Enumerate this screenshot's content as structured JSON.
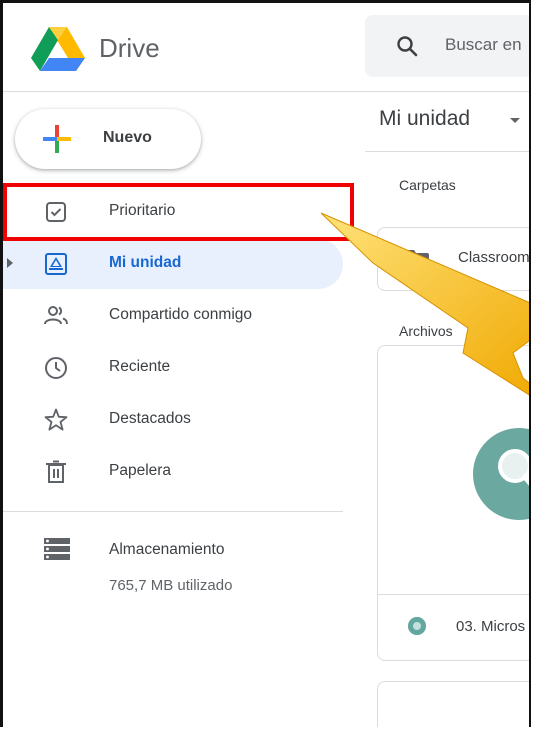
{
  "header": {
    "brand": "Drive",
    "search_placeholder": "Buscar en"
  },
  "sidebar": {
    "new_button": "Nuevo",
    "items": [
      {
        "label": "Prioritario",
        "icon": "checkbox-icon"
      },
      {
        "label": "Mi unidad",
        "icon": "my-drive-icon"
      },
      {
        "label": "Compartido conmigo",
        "icon": "shared-people-icon"
      },
      {
        "label": "Reciente",
        "icon": "clock-icon"
      },
      {
        "label": "Destacados",
        "icon": "star-icon"
      },
      {
        "label": "Papelera",
        "icon": "trash-icon"
      }
    ],
    "storage": {
      "label": "Almacenamiento",
      "used": "765,7 MB utilizado"
    }
  },
  "main": {
    "title": "Mi unidad",
    "folders_heading": "Carpetas",
    "folders": [
      {
        "name": "Classroom"
      }
    ],
    "files_heading": "Archivos",
    "files": [
      {
        "name": "03. Micros"
      }
    ]
  },
  "colors": {
    "accent": "#1967d2",
    "active_bg": "#e8f0fe",
    "annotation": "#f00000",
    "arrow": "#f5b800"
  }
}
